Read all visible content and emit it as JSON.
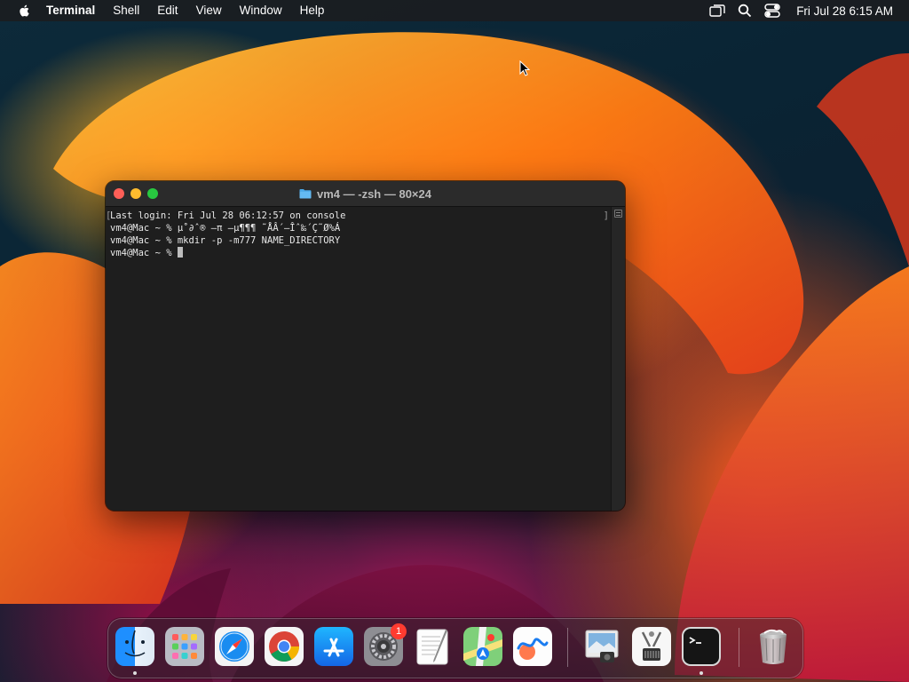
{
  "menubar": {
    "app_name": "Terminal",
    "menus": [
      "Shell",
      "Edit",
      "View",
      "Window",
      "Help"
    ],
    "clock": "Fri Jul 28  6:15 AM",
    "icons": [
      "screen-mirroring-icon",
      "search-icon",
      "control-center-icon"
    ]
  },
  "terminal": {
    "title": "vm4 — -zsh — 80×24",
    "lines": [
      "Last login: Fri Jul 28 06:12:57 on console",
      "vm4@Mac ~ % µ˚∂ˆ® —π —µ¶¶¶ ˜ÅÂ´—Îˆ‰´Ç˜Ø%Á",
      "vm4@Mac ~ % mkdir -p -m777 NAME_DIRECTORY",
      "vm4@Mac ~ % "
    ]
  },
  "dock": {
    "apps": [
      {
        "name": "Finder",
        "running": true
      },
      {
        "name": "Launchpad",
        "running": false
      },
      {
        "name": "Safari",
        "running": false
      },
      {
        "name": "Google Chrome",
        "running": false
      },
      {
        "name": "App Store",
        "running": false
      },
      {
        "name": "System Settings",
        "running": false,
        "badge": "1"
      },
      {
        "name": "TextEdit",
        "running": false
      },
      {
        "name": "Maps",
        "running": false
      },
      {
        "name": "Freeform",
        "running": false
      },
      {
        "name": "Preview",
        "running": false
      },
      {
        "name": "System Information",
        "running": false
      },
      {
        "name": "Terminal",
        "running": true
      },
      {
        "name": "Trash",
        "running": false
      }
    ]
  },
  "colors": {
    "close": "#ff5f57",
    "minimize": "#febc2e",
    "maximize": "#28c840",
    "badge": "#ff3b30"
  }
}
